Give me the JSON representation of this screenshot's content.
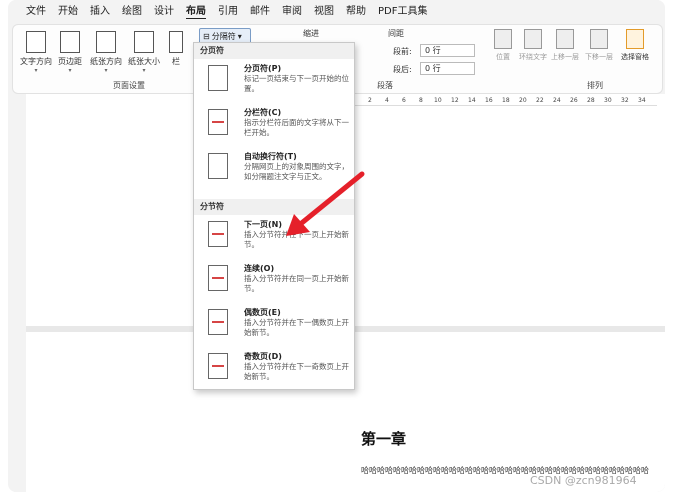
{
  "menubar": {
    "items": [
      "文件",
      "开始",
      "插入",
      "绘图",
      "设计",
      "布局",
      "引用",
      "邮件",
      "审阅",
      "视图",
      "帮助",
      "PDF工具集"
    ],
    "active": "布局"
  },
  "ribbon": {
    "page_setup_buttons": [
      "文字方向",
      "页边距",
      "纸张方向",
      "纸张大小",
      "栏"
    ],
    "page_setup_label": "页面设置",
    "breaks_button": "分隔符",
    "indent_label": "缩进",
    "spacing_label": "间距",
    "spacing_before_label": "段前:",
    "spacing_before_value": "0 行",
    "spacing_after_label": "段后:",
    "spacing_after_value": "0 行",
    "paragraph_label": "段落",
    "arrange_buttons": [
      "位置",
      "环绕文字",
      "上移一层",
      "下移一层",
      "选择窗格"
    ],
    "arrange_label": "排列"
  },
  "ruler": {
    "ticks": [
      "2",
      "4",
      "6",
      "8",
      "10",
      "12",
      "14",
      "16",
      "18",
      "20",
      "22",
      "24",
      "26",
      "28",
      "30",
      "32",
      "34"
    ]
  },
  "dropdown": {
    "page_breaks_header": "分页符",
    "section_breaks_header": "分节符",
    "page_items": [
      {
        "title": "分页符(P)",
        "desc": "标记一页结束与下一页开始的位置。"
      },
      {
        "title": "分栏符(C)",
        "desc": "指示分栏符后面的文字将从下一栏开始。"
      },
      {
        "title": "自动换行符(T)",
        "desc": "分隔网页上的对象周围的文字，如分隔题注文字与正文。"
      }
    ],
    "section_items": [
      {
        "title": "下一页(N)",
        "desc": "插入分节符并在下一页上开始新节。"
      },
      {
        "title": "连续(O)",
        "desc": "插入分节符并在同一页上开始新节。"
      },
      {
        "title": "偶数页(E)",
        "desc": "插入分节符并在下一偶数页上开始新节。"
      },
      {
        "title": "奇数页(D)",
        "desc": "插入分节符并在下一奇数页上开始新节。"
      }
    ]
  },
  "document": {
    "heading": "第一章",
    "body": "哈哈哈哈哈哈哈哈哈哈哈哈哈哈哈哈哈哈哈哈哈哈哈哈哈哈哈哈哈哈哈哈哈哈哈哈"
  },
  "watermark": "CSDN @zcn981964",
  "colors": {
    "arrow": "#e5202a",
    "accent": "#2b579a"
  }
}
